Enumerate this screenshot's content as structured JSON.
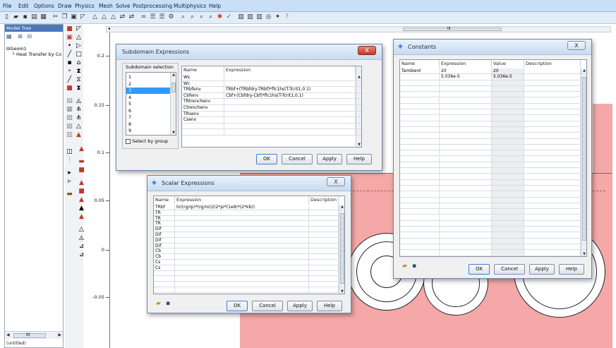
{
  "menu": [
    "File",
    "Edit",
    "Options",
    "Draw",
    "Physics",
    "Mesh",
    "Solve",
    "Postprocessing",
    "Multiphysics",
    "Help"
  ],
  "toolbar_icons": [
    "new-icon",
    "open-icon",
    "save-icon",
    "print-icon",
    "model-tree-icon",
    "cut-icon",
    "copy-icon",
    "paste-icon",
    "select-icon",
    "triangle-icon",
    "triangle-icon",
    "triangle-icon",
    "arrows-icon",
    "arrows-icon",
    "equals-icon",
    "list-icon",
    "list-icon",
    "gear-icon",
    "zoom-icon",
    "zoom-icon",
    "zoom-icon",
    "zoom-icon",
    "solve-icon",
    "check-icon",
    "chart-icon",
    "chart-icon",
    "chart-icon",
    "animation-icon",
    "settings-icon",
    "help-icon"
  ],
  "model_tree": {
    "title": "Model Tree",
    "items": [
      "Geom1",
      "Heat Transfer by Co"
    ],
    "footer": "(untitled)",
    "scroll_label": "III"
  },
  "ruler_label": "III",
  "y_axis": {
    "ticks": [
      "0.2",
      "0.15",
      "0.1",
      "0.05",
      "0",
      "-0.05"
    ]
  },
  "subdomain_dialog": {
    "title": "Subdomain Expressions",
    "selection_label": "Subdomain selection",
    "subdomains": [
      "1",
      "2",
      "3",
      "4",
      "5",
      "6",
      "7",
      "8",
      "9"
    ],
    "selected_index": 2,
    "select_by_group": "Select by group",
    "columns": [
      "Name",
      "Expression"
    ],
    "rows": [
      {
        "name": "Ws",
        "expression": ""
      },
      {
        "name": "Wc",
        "expression": ""
      },
      {
        "name": "TRbfenv",
        "expression": "TRbf+(TRbfdry-TRbf)*flc1hs(T-Tcrit1,0.1)"
      },
      {
        "name": "Cbfenv",
        "expression": "Cbf+(Cbfdry-Cbf)*flc1hs(T-Tcrit1,0.1)"
      },
      {
        "name": "TRtrenchenv",
        "expression": ""
      },
      {
        "name": "Ctrenchenv",
        "expression": ""
      },
      {
        "name": "TRsenv",
        "expression": ""
      },
      {
        "name": "Csenv",
        "expression": ""
      },
      {
        "name": "",
        "expression": ""
      },
      {
        "name": "",
        "expression": ""
      }
    ],
    "buttons": {
      "ok": "OK",
      "cancel": "Cancel",
      "apply": "Apply",
      "help": "Help"
    },
    "close_glyph": "X"
  },
  "scalar_dialog": {
    "title": "Scalar Expressions",
    "columns": [
      "Name",
      "Expression",
      "Description"
    ],
    "rows": [
      {
        "name": "TRbf",
        "expression": "ln((rg/rp)*(rg/ro))/(2*pi*(1e9)*(2*kb))"
      },
      {
        "name": "TR",
        "expression": ""
      },
      {
        "name": "TR",
        "expression": ""
      },
      {
        "name": "TR",
        "expression": ""
      },
      {
        "name": "Dif",
        "expression": ""
      },
      {
        "name": "Dif",
        "expression": ""
      },
      {
        "name": "Dif",
        "expression": ""
      },
      {
        "name": "Dif",
        "expression": ""
      },
      {
        "name": "Cb",
        "expression": ""
      },
      {
        "name": "Cb",
        "expression": ""
      },
      {
        "name": "Cs",
        "expression": ""
      },
      {
        "name": "Cs",
        "expression": ""
      },
      {
        "name": "",
        "expression": ""
      },
      {
        "name": "",
        "expression": ""
      },
      {
        "name": "",
        "expression": ""
      },
      {
        "name": "",
        "expression": ""
      }
    ],
    "buttons": {
      "ok": "OK",
      "cancel": "Cancel",
      "apply": "Apply",
      "help": "Help"
    },
    "close_glyph": "X"
  },
  "constants_dialog": {
    "title": "Constants",
    "columns": [
      "Name",
      "Expression",
      "Value",
      "Description"
    ],
    "rows": [
      {
        "name": "Tambient",
        "expression": "20",
        "value": "20"
      },
      {
        "name": "",
        "expression": "5.036e-5",
        "value": "5.036e-5"
      }
    ],
    "buttons": {
      "ok": "OK",
      "cancel": "Cancel",
      "apply": "Apply",
      "help": "Help"
    },
    "close_glyph": "X"
  },
  "colors": {
    "pink_subdomain": "#f4a8a8",
    "titlebar": "#c7dbf1",
    "menubar": "#c8dff5"
  }
}
